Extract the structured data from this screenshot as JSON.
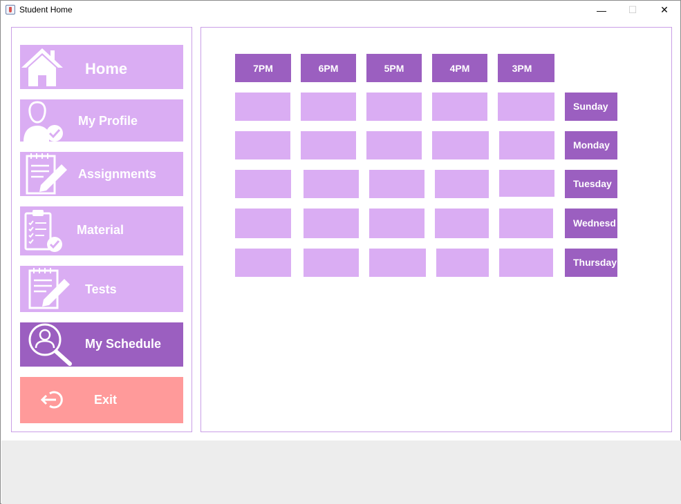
{
  "window": {
    "title": "Student Home",
    "minimize_glyph": "—",
    "maximize_glyph": "☐",
    "close_glyph": "✕"
  },
  "colors": {
    "nav_bg": "#daadf3",
    "active_bg": "#9b5fc0",
    "exit_bg": "#ff9a9a",
    "border": "#c99ee6"
  },
  "sidebar": {
    "items": [
      {
        "label": "Home",
        "icon": "home-icon"
      },
      {
        "label": "My Profile",
        "icon": "user-check-icon"
      },
      {
        "label": "Assignments",
        "icon": "notepad-pencil-icon"
      },
      {
        "label": "Material",
        "icon": "clipboard-checklist-icon"
      },
      {
        "label": "Tests",
        "icon": "notepad-pencil-icon"
      },
      {
        "label": "My Schedule",
        "icon": "user-search-icon",
        "active": true
      },
      {
        "label": "Exit",
        "icon": "logout-icon"
      }
    ]
  },
  "schedule": {
    "times": [
      "7PM",
      "6PM",
      "5PM",
      "4PM",
      "3PM"
    ],
    "days": [
      "Sunday",
      "Monday",
      "Tuesday",
      "Wednesd",
      "Thursday"
    ]
  }
}
